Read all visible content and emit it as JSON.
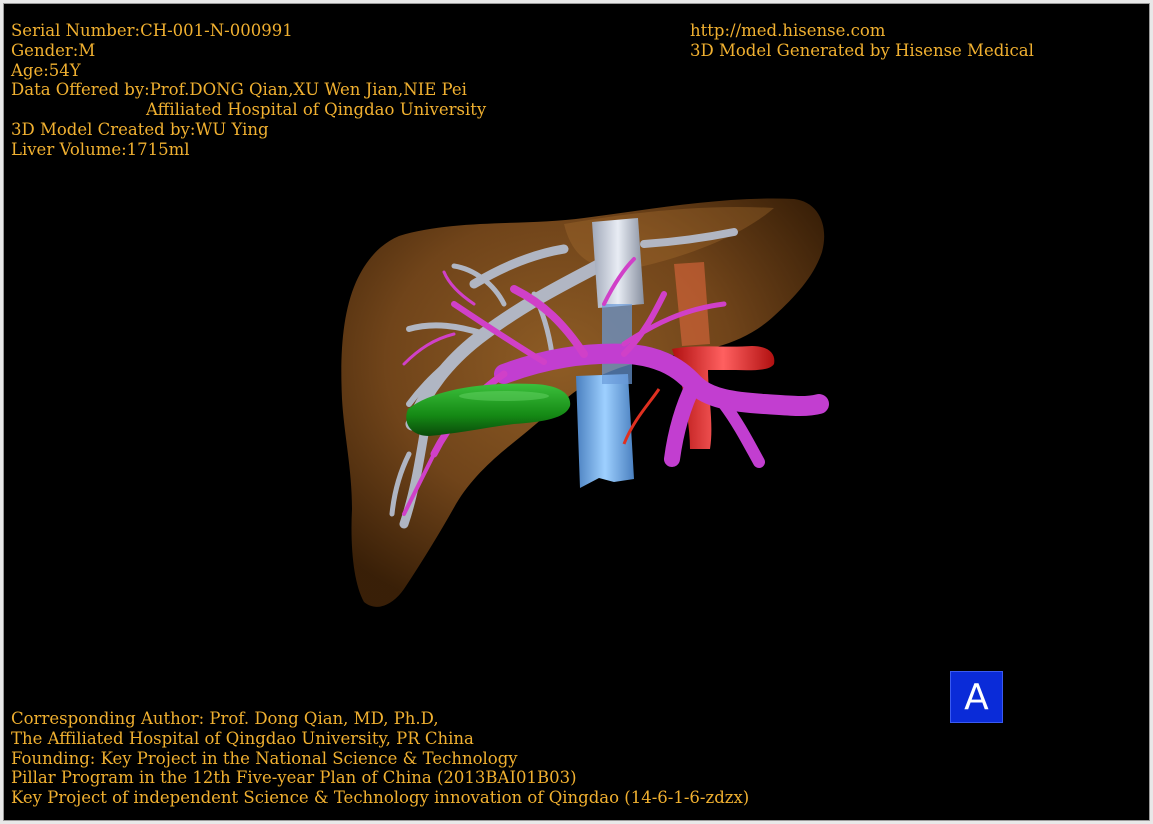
{
  "header_left": {
    "serial_number": "Serial Number:CH-001-N-000991",
    "gender": "Gender:M",
    "age": "Age:54Y",
    "data_offered_by": "Data Offered by:Prof.DONG Qian,XU Wen Jian,NIE Pei",
    "hospital": "Affiliated Hospital of Qingdao University",
    "model_created_by": "3D Model Created by:WU Ying",
    "liver_volume": "Liver Volume:1715ml"
  },
  "header_right": {
    "url": "http://med.hisense.com",
    "generator": "3D Model Generated by Hisense Medical"
  },
  "footer": {
    "line1": "Corresponding Author: Prof. Dong Qian, MD, Ph.D,",
    "line2": "The Affiliated Hospital of Qingdao University, PR China",
    "line3": "Founding: Key Project in the National Science & Technology",
    "line4": "Pillar Program in the 12th Five-year Plan of China (2013BAI01B03)",
    "line5": "Key Project of independent Science & Technology innovation of Qingdao (14-6-1-6-zdzx)"
  },
  "view_badge": {
    "label": "A",
    "color": "#0a2bd8"
  },
  "colors": {
    "text": "#f0b030",
    "background": "#000000",
    "liver": "#7a4a1c",
    "portal_vein": "#c040d0",
    "hepatic_vein": "#a8b4c8",
    "ivc": "#7ab8f0",
    "artery": "#e02020",
    "gallbladder": "#1a8a1a"
  }
}
